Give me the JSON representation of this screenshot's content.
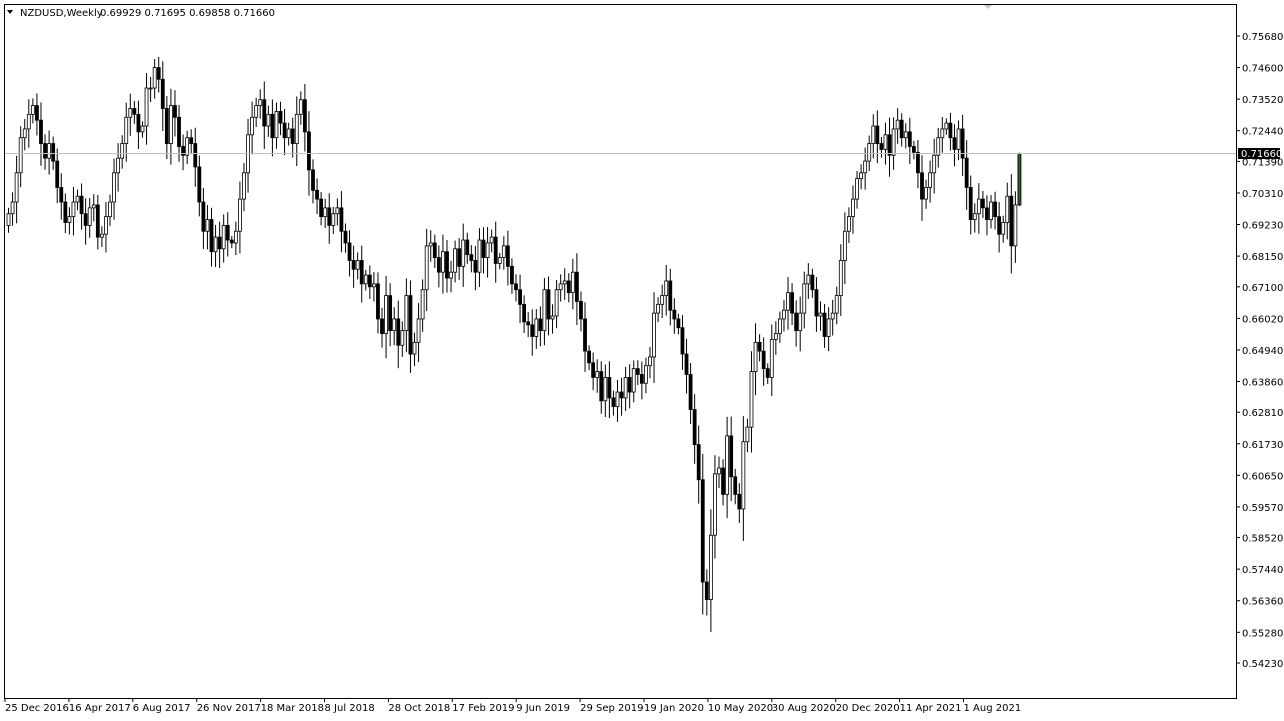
{
  "header": {
    "symbol_timeframe": "NZDUSD,Weekly",
    "ohlc": "0.69929 0.71695 0.69858 0.71660"
  },
  "colors": {
    "background": "#ffffff",
    "frame": "#000000",
    "bull_body": "#ffffff",
    "bear_body": "#000000",
    "last_bull_body": "#2e5a2e",
    "price_line": "#c0c0c0",
    "price_label_bg": "#000000",
    "price_label_text": "#ffffff"
  },
  "chart_data": {
    "type": "candlestick",
    "symbol": "NZDUSD",
    "timeframe": "Weekly",
    "current_price": 0.7166,
    "current_price_label": "0.71660",
    "ylim": [
      0.5423,
      0.7568
    ],
    "y_ticks": [
      "0.75680",
      "0.74600",
      "0.73520",
      "0.72440",
      "0.71390",
      "0.70310",
      "0.69230",
      "0.68150",
      "0.67100",
      "0.66020",
      "0.64940",
      "0.63860",
      "0.62810",
      "0.61730",
      "0.60650",
      "0.59570",
      "0.58520",
      "0.57440",
      "0.56360",
      "0.55280",
      "0.54230"
    ],
    "x_ticks": [
      "25 Dec 2016",
      "16 Apr 2017",
      "6 Aug 2017",
      "26 Nov 2017",
      "18 Mar 2018",
      "8 Jul 2018",
      "28 Oct 2018",
      "17 Feb 2019",
      "9 Jun 2019",
      "29 Sep 2019",
      "19 Jan 2020",
      "10 May 2020",
      "30 Aug 2020",
      "20 Dec 2020",
      "11 Apr 2021",
      "1 Aug 2021"
    ],
    "weekly_closes": [
      0.696,
      0.7,
      0.71,
      0.722,
      0.725,
      0.73,
      0.733,
      0.728,
      0.72,
      0.715,
      0.72,
      0.714,
      0.705,
      0.7,
      0.693,
      0.695,
      0.7,
      0.702,
      0.696,
      0.692,
      0.698,
      0.699,
      0.688,
      0.689,
      0.695,
      0.7,
      0.71,
      0.715,
      0.72,
      0.729,
      0.732,
      0.73,
      0.724,
      0.726,
      0.739,
      0.739,
      0.746,
      0.742,
      0.732,
      0.72,
      0.733,
      0.729,
      0.719,
      0.716,
      0.722,
      0.72,
      0.712,
      0.7,
      0.69,
      0.694,
      0.683,
      0.688,
      0.684,
      0.692,
      0.687,
      0.686,
      0.69,
      0.701,
      0.71,
      0.723,
      0.729,
      0.733,
      0.735,
      0.726,
      0.73,
      0.722,
      0.731,
      0.727,
      0.722,
      0.725,
      0.72,
      0.73,
      0.735,
      0.724,
      0.711,
      0.704,
      0.701,
      0.695,
      0.698,
      0.692,
      0.696,
      0.698,
      0.69,
      0.686,
      0.68,
      0.677,
      0.68,
      0.672,
      0.675,
      0.671,
      0.672,
      0.66,
      0.655,
      0.668,
      0.656,
      0.66,
      0.651,
      0.656,
      0.668,
      0.648,
      0.652,
      0.66,
      0.67,
      0.685,
      0.686,
      0.681,
      0.676,
      0.683,
      0.674,
      0.676,
      0.684,
      0.678,
      0.687,
      0.682,
      0.68,
      0.676,
      0.687,
      0.681,
      0.686,
      0.688,
      0.679,
      0.681,
      0.685,
      0.678,
      0.672,
      0.67,
      0.665,
      0.659,
      0.658,
      0.654,
      0.66,
      0.656,
      0.67,
      0.66,
      0.661,
      0.67,
      0.672,
      0.673,
      0.669,
      0.676,
      0.666,
      0.66,
      0.649,
      0.645,
      0.64,
      0.642,
      0.632,
      0.64,
      0.633,
      0.63,
      0.635,
      0.633,
      0.64,
      0.635,
      0.643,
      0.641,
      0.638,
      0.644,
      0.647,
      0.662,
      0.665,
      0.668,
      0.673,
      0.663,
      0.66,
      0.657,
      0.648,
      0.641,
      0.629,
      0.617,
      0.605,
      0.57,
      0.564,
      0.586,
      0.607,
      0.609,
      0.6,
      0.62,
      0.606,
      0.6,
      0.595,
      0.618,
      0.623,
      0.642,
      0.652,
      0.649,
      0.643,
      0.64,
      0.653,
      0.655,
      0.66,
      0.663,
      0.669,
      0.662,
      0.656,
      0.662,
      0.672,
      0.675,
      0.67,
      0.661,
      0.662,
      0.654,
      0.66,
      0.662,
      0.668,
      0.68,
      0.69,
      0.695,
      0.701,
      0.708,
      0.71,
      0.714,
      0.72,
      0.726,
      0.72,
      0.718,
      0.723,
      0.716,
      0.725,
      0.728,
      0.722,
      0.724,
      0.719,
      0.717,
      0.71,
      0.701,
      0.705,
      0.71,
      0.716,
      0.722,
      0.725,
      0.727,
      0.722,
      0.718,
      0.725,
      0.715,
      0.705,
      0.694,
      0.696,
      0.701,
      0.698,
      0.694,
      0.7,
      0.695,
      0.689,
      0.693,
      0.702,
      0.685,
      0.699,
      0.7166
    ]
  }
}
